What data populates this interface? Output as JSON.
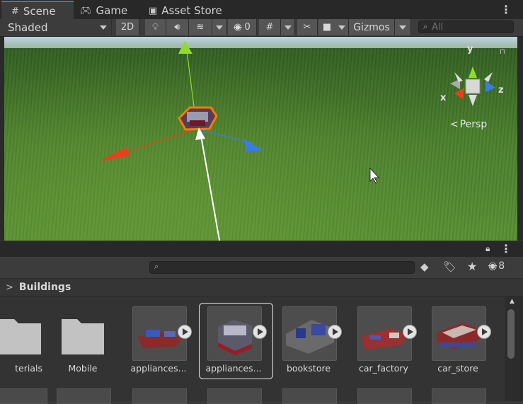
{
  "tabs": [
    {
      "label": "Scene",
      "icon": "grid-icon",
      "active": true
    },
    {
      "label": "Game",
      "icon": "gamepad-icon",
      "active": false
    },
    {
      "label": "Asset Store",
      "icon": "shopping-bag-icon",
      "active": false
    }
  ],
  "toolbar": {
    "shading_mode": "Shaded",
    "mode_2d": "2D",
    "hidden_count": "0",
    "gizmos": "Gizmos",
    "search_placeholder": "All"
  },
  "viewport": {
    "projection_label": "Persp",
    "axis_labels": {
      "x": "x",
      "y": "y",
      "z": "z"
    },
    "colors": {
      "x_axis": "#e8401c",
      "y_axis": "#8fdc2a",
      "z_axis": "#3a7bea",
      "selection_outline": "#ff7a00"
    }
  },
  "project": {
    "hidden_count": "8",
    "breadcrumb": "Buildings",
    "items": [
      {
        "label": "terials",
        "kind": "folder"
      },
      {
        "label": "Mobile",
        "kind": "folder"
      },
      {
        "label": "appliances...",
        "kind": "prefab"
      },
      {
        "label": "appliances...",
        "kind": "prefab",
        "selected": true
      },
      {
        "label": "bookstore",
        "kind": "prefab"
      },
      {
        "label": "car_factory",
        "kind": "prefab"
      },
      {
        "label": "car_store",
        "kind": "prefab"
      }
    ]
  }
}
